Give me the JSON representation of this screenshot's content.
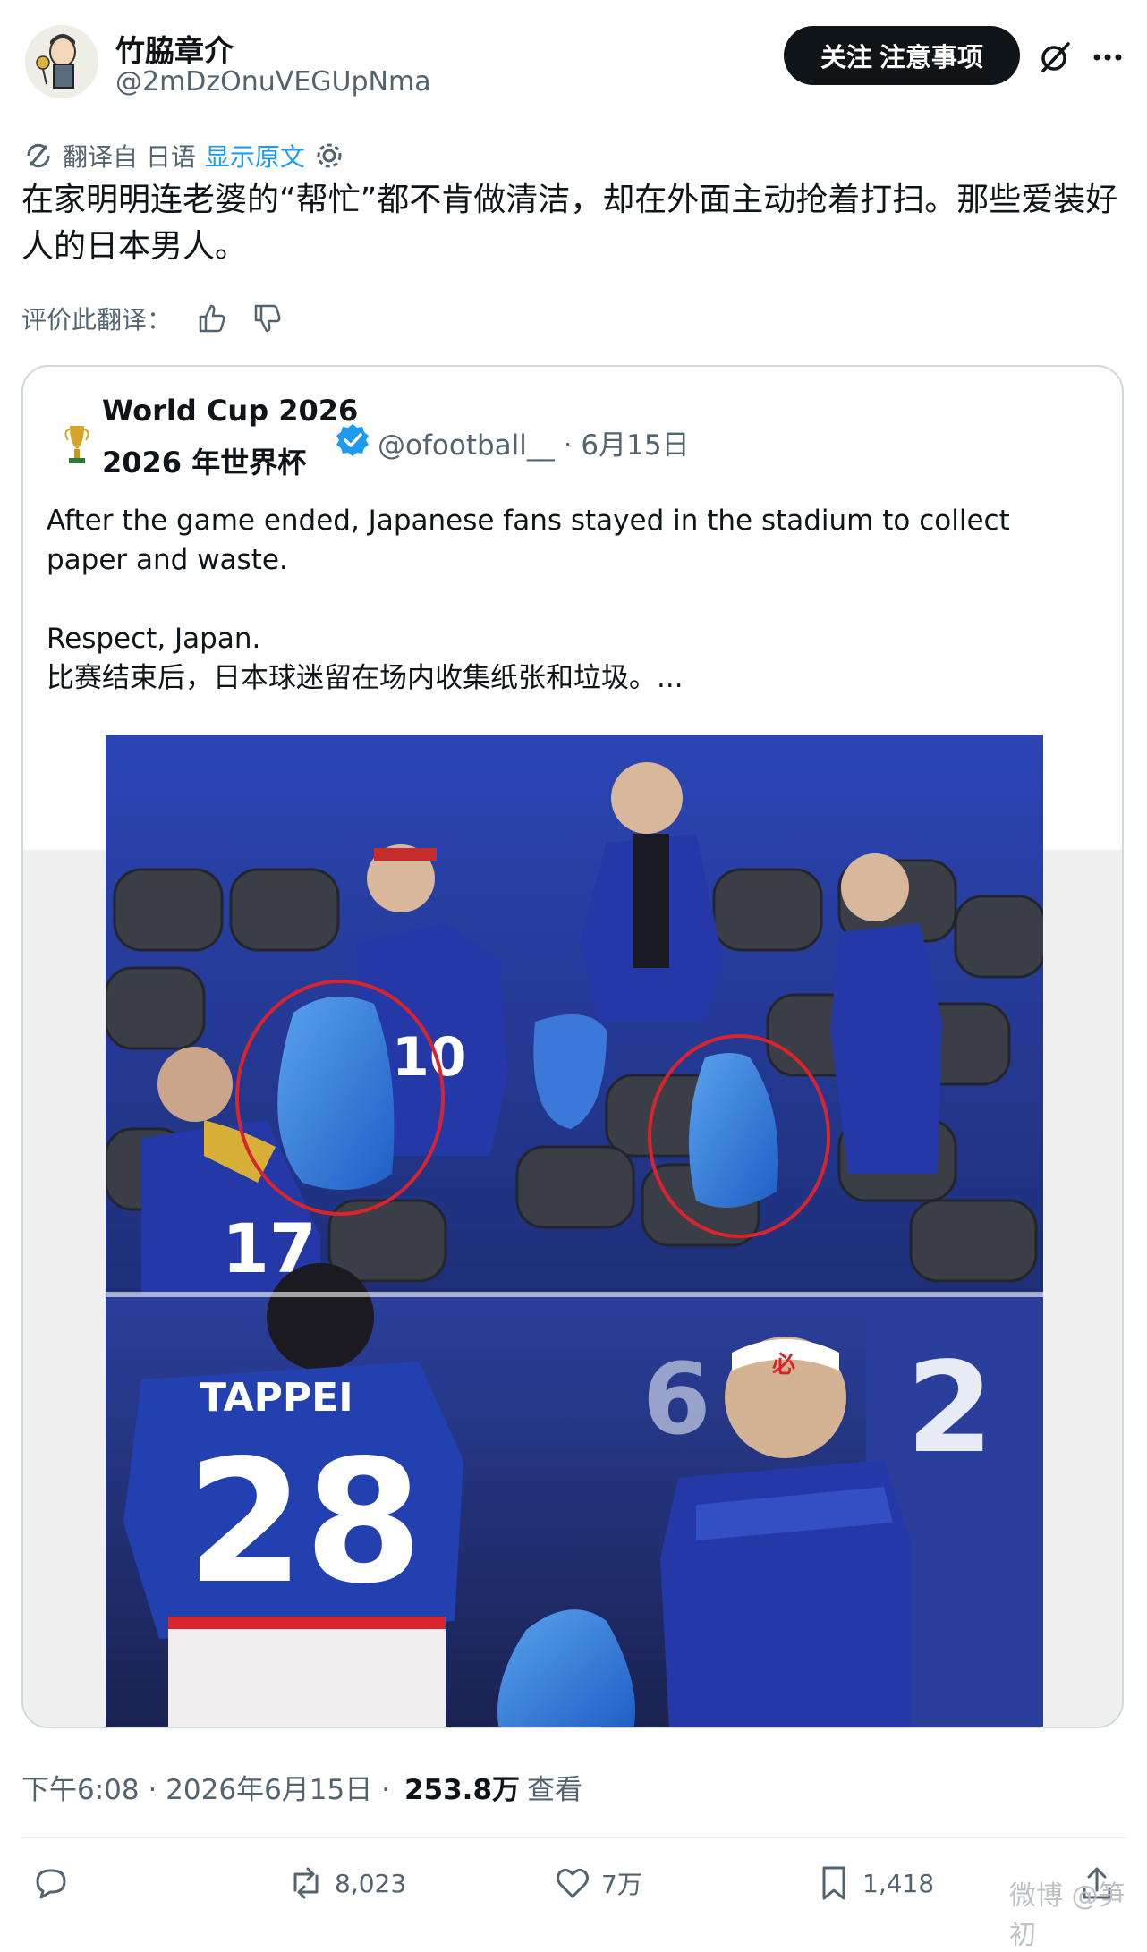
{
  "author": {
    "name": "竹脇章介",
    "handle": "@2mDzOnuVEGUpNma"
  },
  "header": {
    "follow_label": "关注 注意事项"
  },
  "translation": {
    "from_label": "翻译自 日语",
    "show_original": "显示原文"
  },
  "post_text": "在家明明连老婆的“帮忙”都不肯做清洁，却在外面主动抢着打扫。那些爱装好人的日本男人。",
  "rate_label": "评价此翻译：",
  "quote": {
    "name_line1": "World Cup 2026",
    "name_line2": "2026 年世界杯",
    "handle_date": "@ofootball__ · 6月15日",
    "text": "After the game ended, Japanese fans stayed in the stadium to collect paper and waste.\n\nRespect, Japan.\n比赛结束后，日本球迷留在场内收集纸张和垃圾。...",
    "jersey_name": "TAPPEI",
    "jersey_number": "28"
  },
  "meta": {
    "timestamp": "下午6:08 · 2026年6月15日 ·",
    "views": "253.8万",
    "views_label": "查看"
  },
  "actions": {
    "reposts": "8,023",
    "likes": "7万",
    "bookmarks": "1,418"
  },
  "watermark": "微博 @笋初",
  "colors": {
    "link": "#1d9bf0",
    "text_secondary": "#536471",
    "jersey_blue": "#1f3aa8",
    "seat_gray": "#3a3d45"
  }
}
